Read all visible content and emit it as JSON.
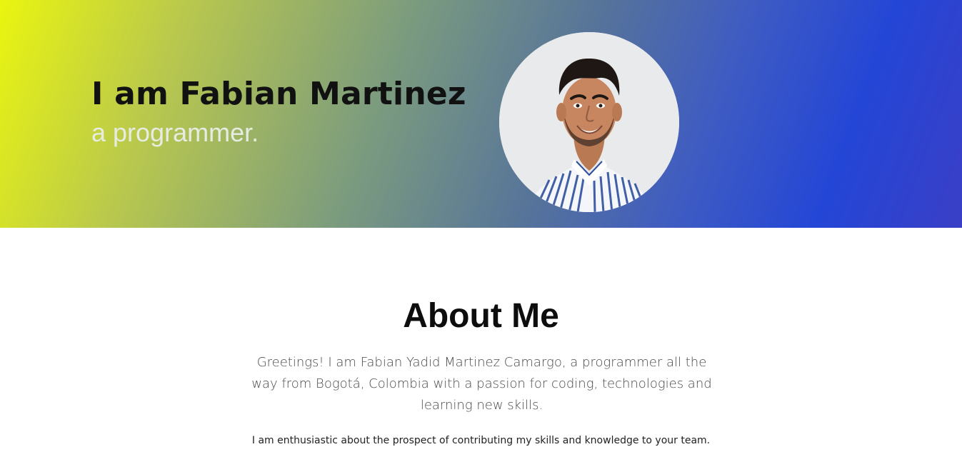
{
  "hero": {
    "name": "I am Fabian Martinez",
    "role": "a programmer.",
    "avatar_alt": "Fabian Martinez portrait"
  },
  "about": {
    "title": "About Me",
    "paragraph": "Greetings! I am Fabian Yadid Martinez Camargo, a programmer all the way from Bogotá, Colombia with a passion for coding, technologies and learning new skills.",
    "note": "I am enthusiastic about the prospect of contributing my skills and knowledge to your team."
  },
  "colors": {
    "gradient_start": "#eaf50f",
    "gradient_mid": "#56739a",
    "gradient_end": "#2446d6",
    "name_text": "#111111",
    "role_text": "#e7ece2",
    "about_title": "#0d0d0d",
    "about_paragraph": "#4a4a4a"
  }
}
